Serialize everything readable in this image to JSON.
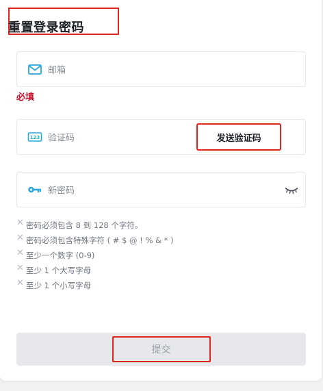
{
  "page": {
    "title": "重置登录密码"
  },
  "form": {
    "email_placeholder": "邮箱",
    "required_label": "必填",
    "code_placeholder": "验证码",
    "send_code_label": "发送验证码",
    "new_password_placeholder": "新密码",
    "submit_label": "提交"
  },
  "password_rules": [
    "密码必须包含 8 到 128 个字符。",
    "密码必须包含特殊字符 ( # $ @ ! % & * )",
    "至少一个数字 (0-9)",
    "至少 1 个大写字母",
    "至少 1 个小写字母"
  ],
  "icons": {
    "email": "mail-icon",
    "code": "123-icon",
    "password": "key-icon",
    "toggle": "eye-closed-icon",
    "rule_status": "x-icon"
  },
  "colors": {
    "accent": "#2aa8e0",
    "required": "#c8102e",
    "highlight_border": "#e0261c"
  }
}
